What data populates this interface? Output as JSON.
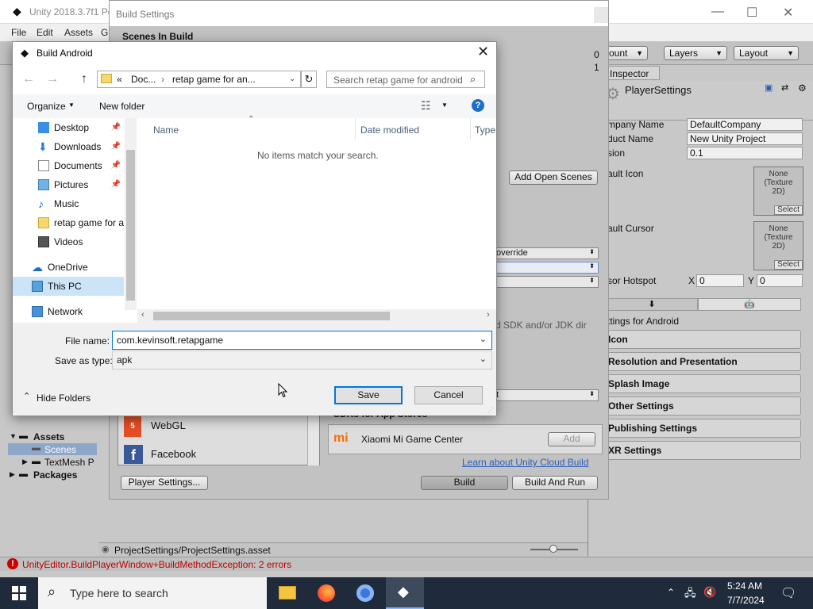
{
  "unity": {
    "title": "Unity 2018.3.7f1 Pe",
    "menu": [
      "File",
      "Edit",
      "Assets",
      "G"
    ],
    "toolbar": {
      "account": "ount",
      "layers": "Layers",
      "layout": "Layout"
    },
    "inspector": {
      "tab": "Inspector",
      "object": "PlayerSettings",
      "fields": [
        {
          "label": "mpany Name",
          "value": "DefaultCompany"
        },
        {
          "label": "duct Name",
          "value": "New Unity Project"
        },
        {
          "label": "sion",
          "value": "0.1"
        }
      ],
      "default_icon_label": "ault Icon",
      "default_cursor_label": "ault Cursor",
      "texture_none": "None\n(Texture\n2D)",
      "select": "Select",
      "hotspot_label": "sor Hotspot",
      "hotspot_x_label": "X",
      "hotspot_x": "0",
      "hotspot_y_label": "Y",
      "hotspot_y": "0",
      "settings_for": "ttings for Android",
      "sections": [
        "Icon",
        "Resolution and Presentation",
        "Splash Image",
        "Other Settings",
        "Publishing Settings",
        "XR Settings"
      ]
    },
    "project": {
      "assets": "Assets",
      "scenes": "Scenes",
      "textmesh": "TextMesh P",
      "packages": "Packages"
    },
    "status_path": "ProjectSettings/ProjectSettings.asset",
    "error": "UnityEditor.BuildPlayerWindow+BuildMethodException: 2 errors"
  },
  "build_settings": {
    "title": "Build Settings",
    "scenes_in_build": "Scenes In Build",
    "scene_numbers": [
      "0",
      "1"
    ],
    "add_open_scenes": "Add Open Scenes",
    "override": "override",
    "sdk_note": "d SDK and/or JDK dir",
    "platforms": [
      "WebGL",
      "Facebook"
    ],
    "sdks_header": "SDKs for App Stores",
    "xiaomi": "Xiaomi Mi Game Center",
    "add": "Add",
    "learn_link": "Learn about Unity Cloud Build",
    "player_settings": "Player Settings...",
    "build": "Build",
    "build_and_run": "Build And Run"
  },
  "dialog": {
    "title": "Build Android",
    "address": {
      "prefix": "«",
      "parts": [
        "Doc...",
        "retap game for an..."
      ]
    },
    "search_placeholder": "Search retap game for android",
    "organize": "Organize",
    "new_folder": "New folder",
    "nav": [
      {
        "label": "Desktop",
        "icon": "desktop-icon",
        "pinned": true
      },
      {
        "label": "Downloads",
        "icon": "downloads-icon",
        "pinned": true
      },
      {
        "label": "Documents",
        "icon": "documents-icon",
        "pinned": true
      },
      {
        "label": "Pictures",
        "icon": "pictures-icon",
        "pinned": true
      },
      {
        "label": "Music",
        "icon": "music-icon",
        "pinned": false
      },
      {
        "label": "retap game for a",
        "icon": "folder-icon",
        "pinned": false
      },
      {
        "label": "Videos",
        "icon": "videos-icon",
        "pinned": false
      },
      {
        "label": "OneDrive",
        "icon": "onedrive-icon",
        "pinned": false
      },
      {
        "label": "This PC",
        "icon": "pc-icon",
        "pinned": false
      },
      {
        "label": "Network",
        "icon": "network-icon",
        "pinned": false
      }
    ],
    "columns": [
      "Name",
      "Date modified",
      "Type"
    ],
    "empty_message": "No items match your search.",
    "file_name_label": "File name:",
    "file_name": "com.kevinsoft.retapgame",
    "save_type_label": "Save as type:",
    "save_type": "apk",
    "hide_folders": "Hide Folders",
    "save": "Save",
    "cancel": "Cancel"
  },
  "taskbar": {
    "search_placeholder": "Type here to search",
    "time": "5:24 AM",
    "date": "7/7/2024"
  },
  "colors": {
    "accent": "#0078d7",
    "taskbar": "#1f2a3a",
    "unity_bg": "#c2c2c2",
    "error": "#cc0000"
  }
}
